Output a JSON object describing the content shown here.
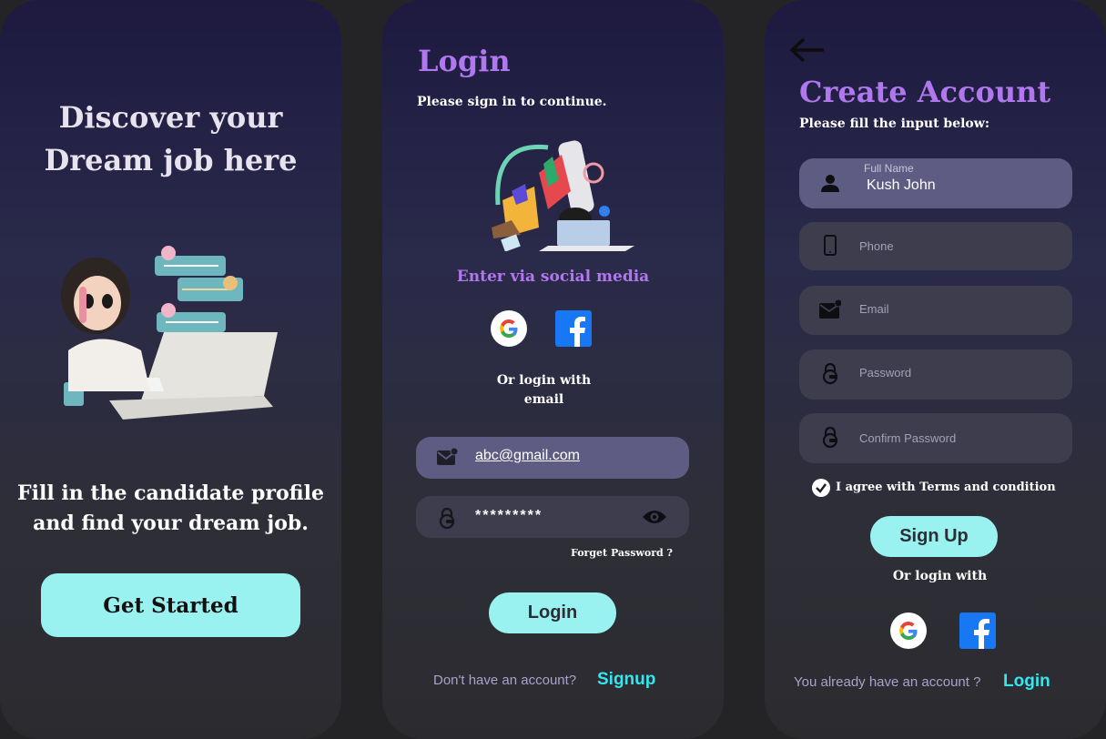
{
  "welcome": {
    "title_line1": "Discover your",
    "title_line2": "Dream job here",
    "subtitle_line1": "Fill in the candidate profile",
    "subtitle_line2": "and find your dream job.",
    "cta_label": "Get Started"
  },
  "login": {
    "title": "Login",
    "subtitle": "Please sign in to continue.",
    "social_heading": "Enter via social media",
    "or_line1": "Or login with",
    "or_line2": "email",
    "email_value": "abc@gmail.com",
    "password_value": "*********",
    "forget_label": "Forget Password ?",
    "login_button": "Login",
    "footer_text": "Don't have an account?",
    "signup_link": "Signup"
  },
  "signup": {
    "title": "Create Account",
    "subtitle": "Please fill the input below:",
    "fullname_label": "Full Name",
    "fullname_value": "Kush John",
    "phone_placeholder": "Phone",
    "email_placeholder": "Email",
    "password_placeholder": "Password",
    "confirm_placeholder": "Confirm Password",
    "agree_text": "I agree with Terms and condition",
    "agree_checked": true,
    "signup_button": "Sign Up",
    "or_text": "Or login with",
    "footer_text": "You already have an account ?",
    "login_link": "Login"
  },
  "icons": {
    "back": "arrow-left-icon",
    "google": "google-icon",
    "facebook": "facebook-icon",
    "email": "mail-icon",
    "lock": "lock-icon",
    "eye": "eye-icon",
    "user": "user-icon",
    "phone": "phone-icon",
    "check": "check-icon"
  },
  "colors": {
    "accent_purple": "#b077ee",
    "button_cyan": "#9af2f0",
    "link_cyan": "#34e6ee",
    "field_bg": "#3d3d4e",
    "field_active_bg": "#5e5c82"
  }
}
